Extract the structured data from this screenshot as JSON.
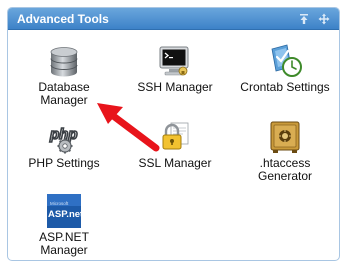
{
  "panel": {
    "title": "Advanced Tools"
  },
  "tools": [
    {
      "label": "Database Manager",
      "icon": "database-icon"
    },
    {
      "label": "SSH Manager",
      "icon": "terminal-icon"
    },
    {
      "label": "Crontab Settings",
      "icon": "crontab-clock-icon"
    },
    {
      "label": "PHP Settings",
      "icon": "php-icon"
    },
    {
      "label": "SSL Manager",
      "icon": "ssl-lock-icon"
    },
    {
      "label": ".htaccess Generator",
      "icon": "safe-icon"
    },
    {
      "label": "ASP.NET Manager",
      "icon": "aspnet-icon"
    }
  ],
  "icons": {
    "aspnet_small": "Microsoft",
    "aspnet_big": "ASP.net",
    "php": "php"
  },
  "colors": {
    "header_top": "#6aa6dc",
    "header_bottom": "#3d82c8",
    "panel_border": "#a9c6e3",
    "annotation_arrow": "#e8141b"
  }
}
